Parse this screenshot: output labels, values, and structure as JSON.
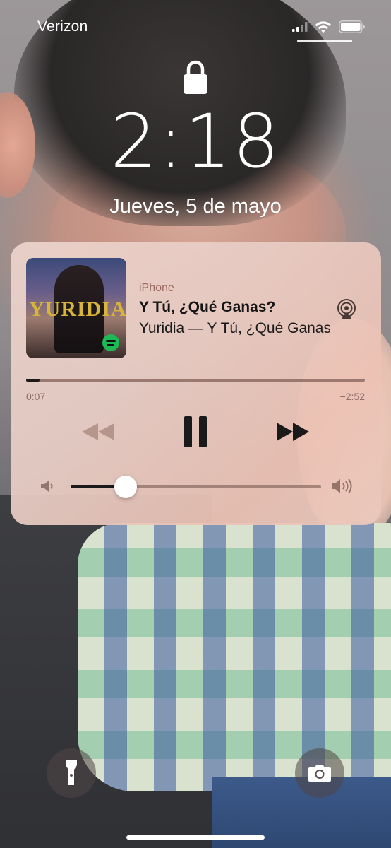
{
  "status_bar": {
    "carrier": "Verizon",
    "signal_icon": "cellular-signal-icon",
    "wifi_icon": "wifi-icon",
    "battery_icon": "battery-icon"
  },
  "lock_screen": {
    "lock_icon": "lock-icon",
    "time": "2:18",
    "date": "Jueves, 5 de mayo"
  },
  "now_playing": {
    "source": "iPhone",
    "title": "Y Tú, ¿Qué Ganas?",
    "subtitle": "Yuridia — Y Tú, ¿Qué Ganas?",
    "album_art_text": "YURIDIA",
    "airplay_icon": "airplay-icon",
    "progress_fraction": 0.04,
    "elapsed": "0:07",
    "remaining": "−2:52",
    "controls": {
      "previous_icon": "rewind-icon",
      "play_pause_icon": "pause-icon",
      "next_icon": "fast-forward-icon"
    },
    "volume_fraction": 0.22,
    "volume_low_icon": "speaker-low-icon",
    "volume_high_icon": "speaker-high-icon"
  },
  "quick_actions": {
    "flashlight_icon": "flashlight-icon",
    "camera_icon": "camera-icon"
  }
}
